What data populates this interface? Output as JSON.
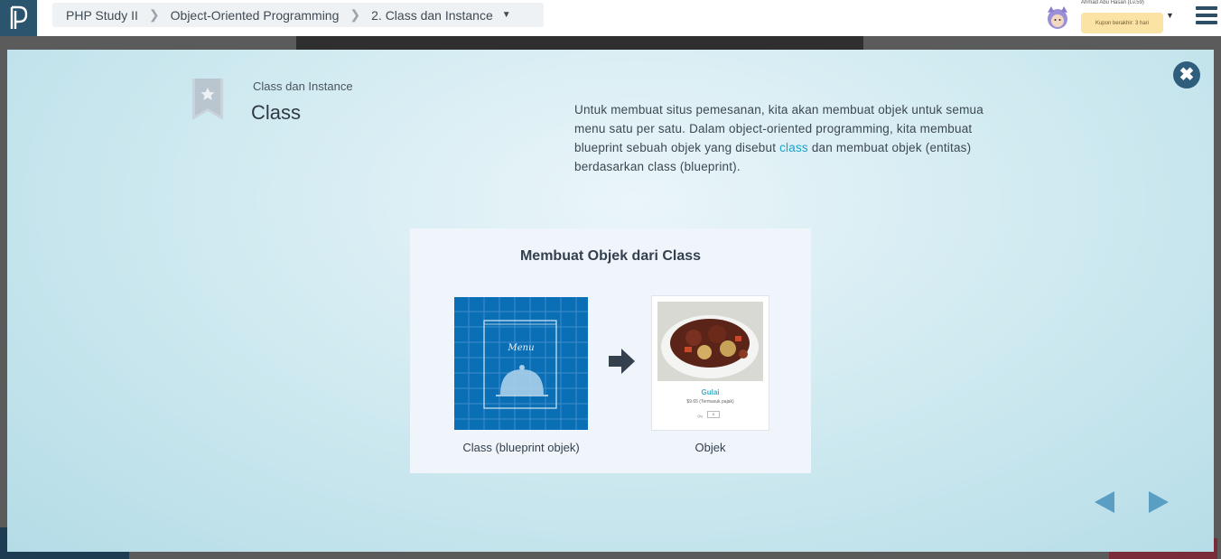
{
  "header": {
    "breadcrumb": [
      "PHP Study II",
      "Object-Oriented Programming",
      "2. Class dan Instance"
    ],
    "user_name": "Ahmad Abu Hasan (Lv.59)",
    "coupon_text": "Kupon berakhir: 3 hari"
  },
  "modal": {
    "subtitle": "Class dan Instance",
    "title": "Class",
    "description_before": "Untuk membuat situs pemesanan, kita akan membuat objek untuk semua menu satu per satu. Dalam object-oriented programming, kita membuat blueprint sebuah objek yang disebut ",
    "description_keyword": "class",
    "description_after": " dan membuat objek (entitas) berdasarkan class (blueprint).",
    "figure": {
      "title": "Membuat Objek dari Class",
      "blueprint_label": "Menu",
      "food_name": "Gulai",
      "food_price": "$9.65 (Termasuk pajak)",
      "qty_label": "Qty",
      "qty_value": "0",
      "caption_class": "Class (blueprint objek)",
      "caption_objek": "Objek"
    }
  },
  "colors": {
    "accent": "#1aa2c8",
    "header_dark": "#2b546e",
    "blueprint_blue": "#0b6fb5"
  }
}
